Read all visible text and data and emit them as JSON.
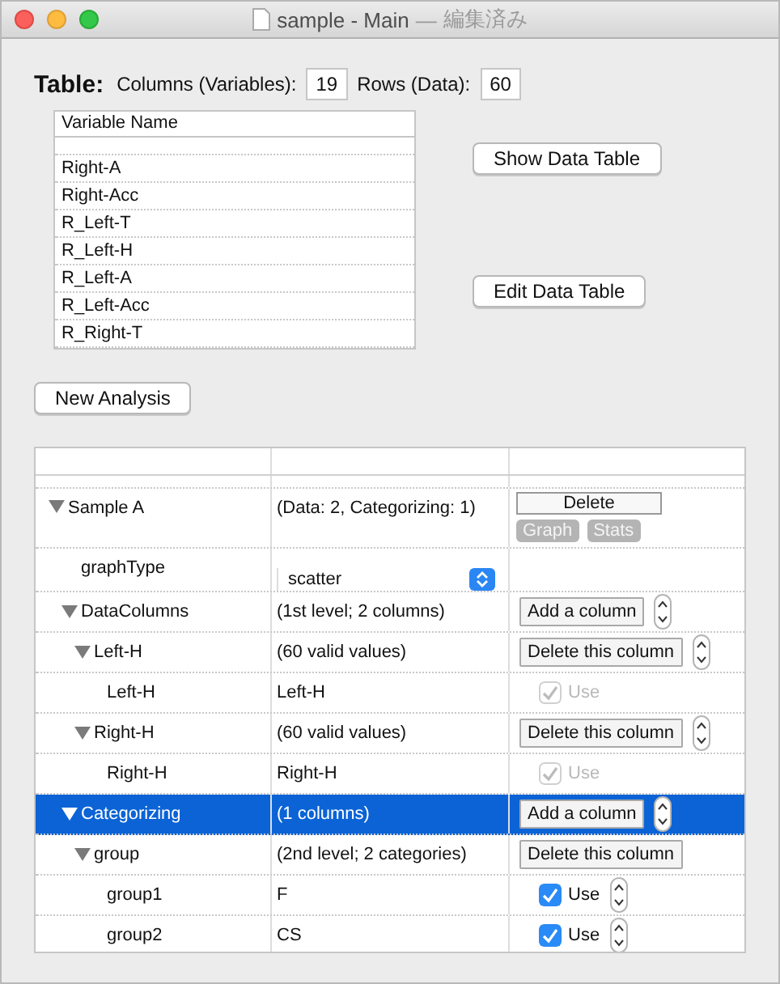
{
  "window": {
    "title": "sample - Main",
    "separator": "—",
    "status": "編集済み"
  },
  "table": {
    "label": "Table:",
    "columns_label": "Columns (Variables):",
    "columns_value": "19",
    "rows_label": "Rows (Data):",
    "rows_value": "60"
  },
  "variables": {
    "header": "Variable Name",
    "items": [
      "Right-A",
      "Right-Acc",
      "R_Left-T",
      "R_Left-H",
      "R_Left-A",
      "R_Left-Acc",
      "R_Right-T"
    ]
  },
  "buttons": {
    "show": "Show Data Table",
    "edit": "Edit Data Table",
    "new_analysis": "New Analysis"
  },
  "outline": {
    "rows": [
      {
        "name": "Sample A",
        "value": "(Data: 2, Categorizing: 1)",
        "kind": "sample",
        "expanded": true,
        "selected": false,
        "delete": "Delete",
        "actions": [
          {
            "label": "Graph",
            "disabled": true
          },
          {
            "label": "Stats",
            "disabled": true
          }
        ],
        "children": [
          {
            "name": "graphType",
            "kind": "select",
            "option": "scatter",
            "selected": false
          },
          {
            "name": "DataColumns",
            "value": "(1st level; 2 columns)",
            "kind": "button",
            "button": "Add a column",
            "stepper": true,
            "expanded": true,
            "selected": false,
            "children": [
              {
                "name": "Left-H",
                "value": "(60 valid values)",
                "kind": "button",
                "button": "Delete this column",
                "stepper": true,
                "expanded": true,
                "selected": false,
                "children": [
                  {
                    "name": "Left-H",
                    "value": "Left-H",
                    "kind": "use",
                    "label": "Use",
                    "checked": true,
                    "disabled": true,
                    "stepper": false,
                    "selected": false
                  }
                ]
              },
              {
                "name": "Right-H",
                "value": "(60 valid values)",
                "kind": "button",
                "button": "Delete this column",
                "stepper": true,
                "expanded": true,
                "selected": false,
                "children": [
                  {
                    "name": "Right-H",
                    "value": "Right-H",
                    "kind": "use",
                    "label": "Use",
                    "checked": true,
                    "disabled": true,
                    "stepper": false,
                    "selected": false
                  }
                ]
              }
            ]
          },
          {
            "name": "Categorizing",
            "value": "(1 columns)",
            "kind": "button",
            "button": "Add a column",
            "stepper": true,
            "expanded": true,
            "selected": true,
            "children": [
              {
                "name": "group",
                "value": "(2nd level; 2 categories)",
                "kind": "button",
                "button": "Delete this column",
                "stepper": false,
                "expanded": true,
                "selected": false,
                "children": [
                  {
                    "name": "group1",
                    "value": "F",
                    "kind": "use",
                    "label": "Use",
                    "checked": true,
                    "disabled": false,
                    "stepper": true,
                    "selected": false
                  },
                  {
                    "name": "group2",
                    "value": "CS",
                    "kind": "use",
                    "label": "Use",
                    "checked": true,
                    "disabled": false,
                    "stepper": true,
                    "selected": false
                  }
                ]
              }
            ]
          }
        ]
      }
    ]
  }
}
